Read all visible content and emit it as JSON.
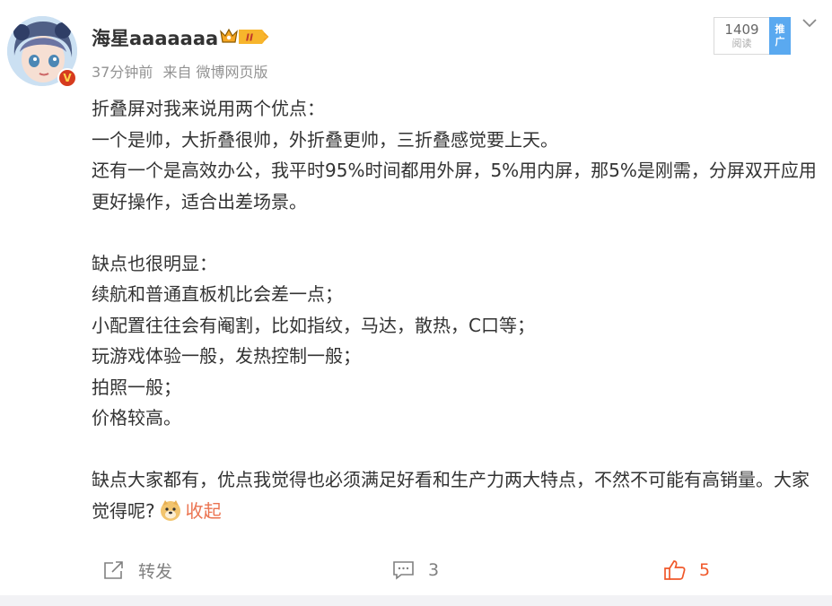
{
  "post": {
    "author": "海星aaaaaaa",
    "vip_level": "II",
    "time": "37分钟前",
    "source": "来自 微博网页版",
    "read_count": "1409",
    "read_label": "阅读",
    "promote_tag": [
      "推",
      "广"
    ],
    "verified_mark": "V",
    "paragraphs": [
      "折叠屏对我来说用两个优点：",
      "一个是帅，大折叠很帅，外折叠更帅，三折叠感觉要上天。",
      "还有一个是高效办公，我平时95%时间都用外屏，5%用内屏，那5%是刚需，分屏双开应用更好操作，适合出差场景。",
      "",
      "缺点也很明显：",
      "续航和普通直板机比会差一点；",
      "小配置往往会有阉割，比如指纹，马达，散热，C口等；",
      "玩游戏体验一般，发热控制一般；",
      "拍照一般；",
      "价格较高。",
      "",
      "缺点大家都有，优点我觉得也必须满足好看和生产力两大特点，不然不可能有高销量。大家觉得呢?"
    ],
    "emoji": "doge-emoji",
    "collapse_label": "收起"
  },
  "actions": {
    "repost_label": "转发",
    "comment_count": "3",
    "like_count": "5"
  },
  "colors": {
    "accent": "#eb7350",
    "like": "#f0582a",
    "meta": "#939393",
    "promote": "#5aa9f0",
    "vip": "#f5a623"
  }
}
